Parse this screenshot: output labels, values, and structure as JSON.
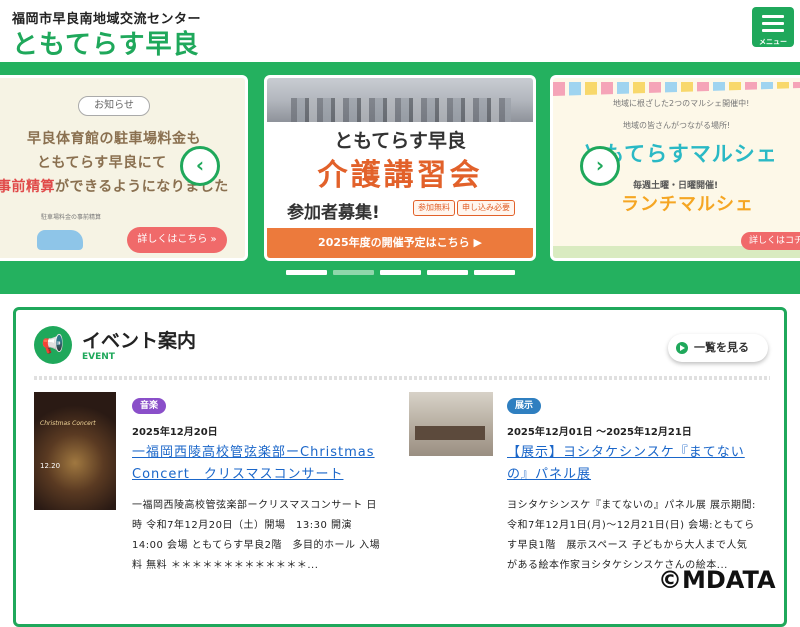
{
  "header": {
    "subtitle": "福岡市早良南地域交流センター",
    "logo": "ともてらす早良",
    "menu_label": "メニュー"
  },
  "carousel": {
    "prev_icon": "chevron-left-icon",
    "next_icon": "chevron-right-icon",
    "active_dot": 1,
    "dot_count": 5,
    "slides": [
      {
        "notice": "お知らせ",
        "line1": "早良体育館の駐車場料金も",
        "line2": "ともてらす早良にて",
        "line3_red": "事前精算",
        "line3_rest": "ができるようになりました",
        "car_note": "駐車場料金の事前精算",
        "button": "詳しくはこちら »"
      },
      {
        "title": "ともてらす早良",
        "headline": "介護講習会",
        "recruit": "参加者募集!",
        "tag1": "参加無料",
        "tag2": "申し込み必要",
        "button": "2025年度の開催予定はこちら ▶"
      },
      {
        "top_line1": "地域に根ざした2つのマルシェ開催中!",
        "top_line2": "地域の皆さんがつながる場所!",
        "marche1": "ともてらすマルシェ",
        "schedule": "毎週土曜・日曜開催!",
        "marche2": "ランチマルシェ",
        "button": "詳しくはコチ"
      }
    ]
  },
  "events": {
    "title": "イベント案内",
    "subtitle": "EVENT",
    "view_all": "一覧を見る",
    "items": [
      {
        "category": "音楽",
        "category_color": "#8a4fc9",
        "date": "2025年12月20日",
        "title": "一福岡西陵高校管弦楽部ーChristmas Concert　クリスマスコンサート",
        "description": "一福岡西陵高校管弦楽部ークリスマスコンサート 日時 令和7年12月20日（土）開場　13:30 開演　14:00 会場 ともてらす早良2階　多目的ホール 入場料 無料 ＊＊＊＊＊＊＊＊＊＊＊＊＊...",
        "thumb_caption": "Christmas Concert",
        "thumb_date": "12.20"
      },
      {
        "category": "展示",
        "category_color": "#2f7fc0",
        "date": "2025年12月01日 ～2025年12月21日",
        "title": "【展示】ヨシタケシンスケ『まてないの』パネル展",
        "description": "ヨシタケシンスケ『まてないの』パネル展 展示期間:令和7年12月1日(月)～12月21日(日) 会場:ともてらす早良1階　展示スペース 子どもから大人まで人気がある絵本作家ヨシタケシンスケさんの絵本..."
      }
    ]
  },
  "watermark": "©MDATA",
  "colors": {
    "brand_green": "#1fa85b",
    "hero_green": "#24b15f",
    "link_blue": "#1a66c9",
    "accent_orange": "#e2612a"
  }
}
